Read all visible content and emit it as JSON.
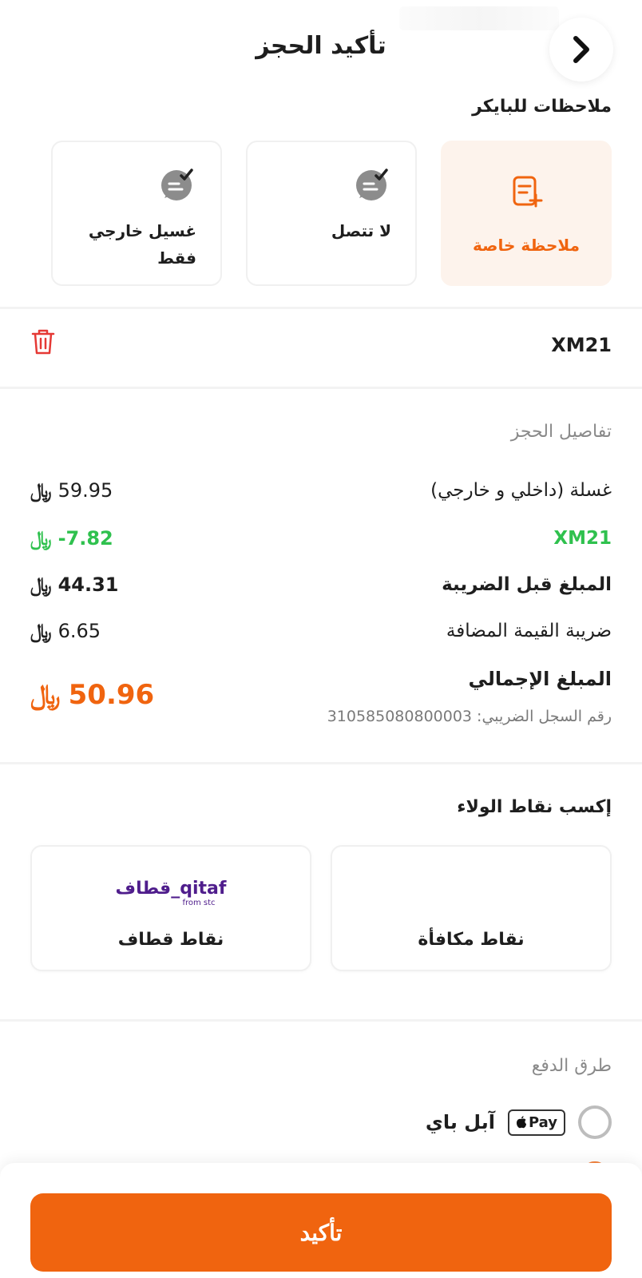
{
  "header": {
    "title": "تأكيد الحجز"
  },
  "notes": {
    "title": "ملاحظات للبايكر",
    "items": [
      {
        "label": "ملاحظة خاصة"
      },
      {
        "label": "لا تتصل"
      },
      {
        "label": "غسيل خارجي فقط"
      }
    ]
  },
  "promo": {
    "code": "XM21"
  },
  "booking": {
    "title": "تفاصيل الحجز",
    "rows": [
      {
        "label": "غسلة (داخلي و خارجي)",
        "amount": "59.95"
      },
      {
        "label": "XM21",
        "amount": "-7.82"
      },
      {
        "label": "المبلغ قبل الضريبة",
        "amount": "44.31"
      },
      {
        "label": "ضريبة القيمة المضافة",
        "amount": "6.65"
      }
    ],
    "total_label": "المبلغ الإجمالي",
    "total_amount": "50.96",
    "tax_reg": "رقم السجل الضريبي: 310585080800003",
    "currency_symbol": "﷼"
  },
  "loyalty": {
    "title": "إكسب نقاط الولاء",
    "rewards_label": "نقاط مكافأة",
    "qitaf_label": "نقاط قطاف",
    "qitaf_logo_text": "قطاف_qitaf",
    "qitaf_logo_sub": "from stc"
  },
  "payment": {
    "title": "طرق الدفع",
    "apple_label": "آبل باي",
    "apple_badge": "Pay"
  },
  "confirm_label": "تأكيد",
  "colors": {
    "accent": "#f0640f",
    "success": "#2fc14e",
    "qitaf": "#4f1d8c"
  }
}
